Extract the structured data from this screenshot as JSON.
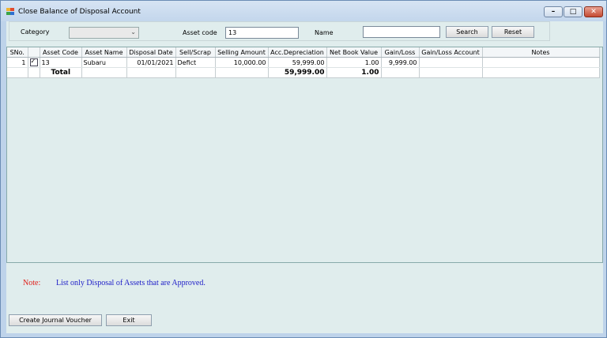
{
  "window": {
    "title": "Close Balance of Disposal Account"
  },
  "window_buttons": {
    "minimize": "–",
    "maximize": "□",
    "close": "✕"
  },
  "filters": {
    "category_label": "Category",
    "category_value": "",
    "asset_code_label": "Asset code",
    "asset_code_value": "13",
    "name_label": "Name",
    "name_value": "",
    "search_label": "Search",
    "reset_label": "Reset"
  },
  "grid": {
    "columns": [
      "SNo.",
      "",
      "Asset Code",
      "Asset Name",
      "Disposal Date",
      "Sell/Scrap",
      "Selling Amount",
      "Acc.Depreciation",
      "Net Book Value",
      "Gain/Loss",
      "Gain/Loss Account",
      "Notes"
    ],
    "rows": [
      {
        "sno": "1",
        "checked": true,
        "asset_code": "13",
        "asset_name": "Subaru",
        "disposal_date": "01/01/2021",
        "sell_scrap": "Defict",
        "selling_amount": "10,000.00",
        "acc_depreciation": "59,999.00",
        "net_book_value": "1.00",
        "gain_loss": "9,999.00",
        "gain_loss_account": "",
        "notes": ""
      }
    ],
    "total": {
      "label": "Total",
      "acc_depreciation": "59,999.00",
      "net_book_value": "1.00"
    }
  },
  "note": {
    "label": "Note:",
    "text": "List only Disposal of Assets that are Approved.",
    "label_color": "#e0201a",
    "text_color": "#2020c8"
  },
  "actions": {
    "create_jv_label": "Create Journal Voucher",
    "exit_label": "Exit"
  }
}
